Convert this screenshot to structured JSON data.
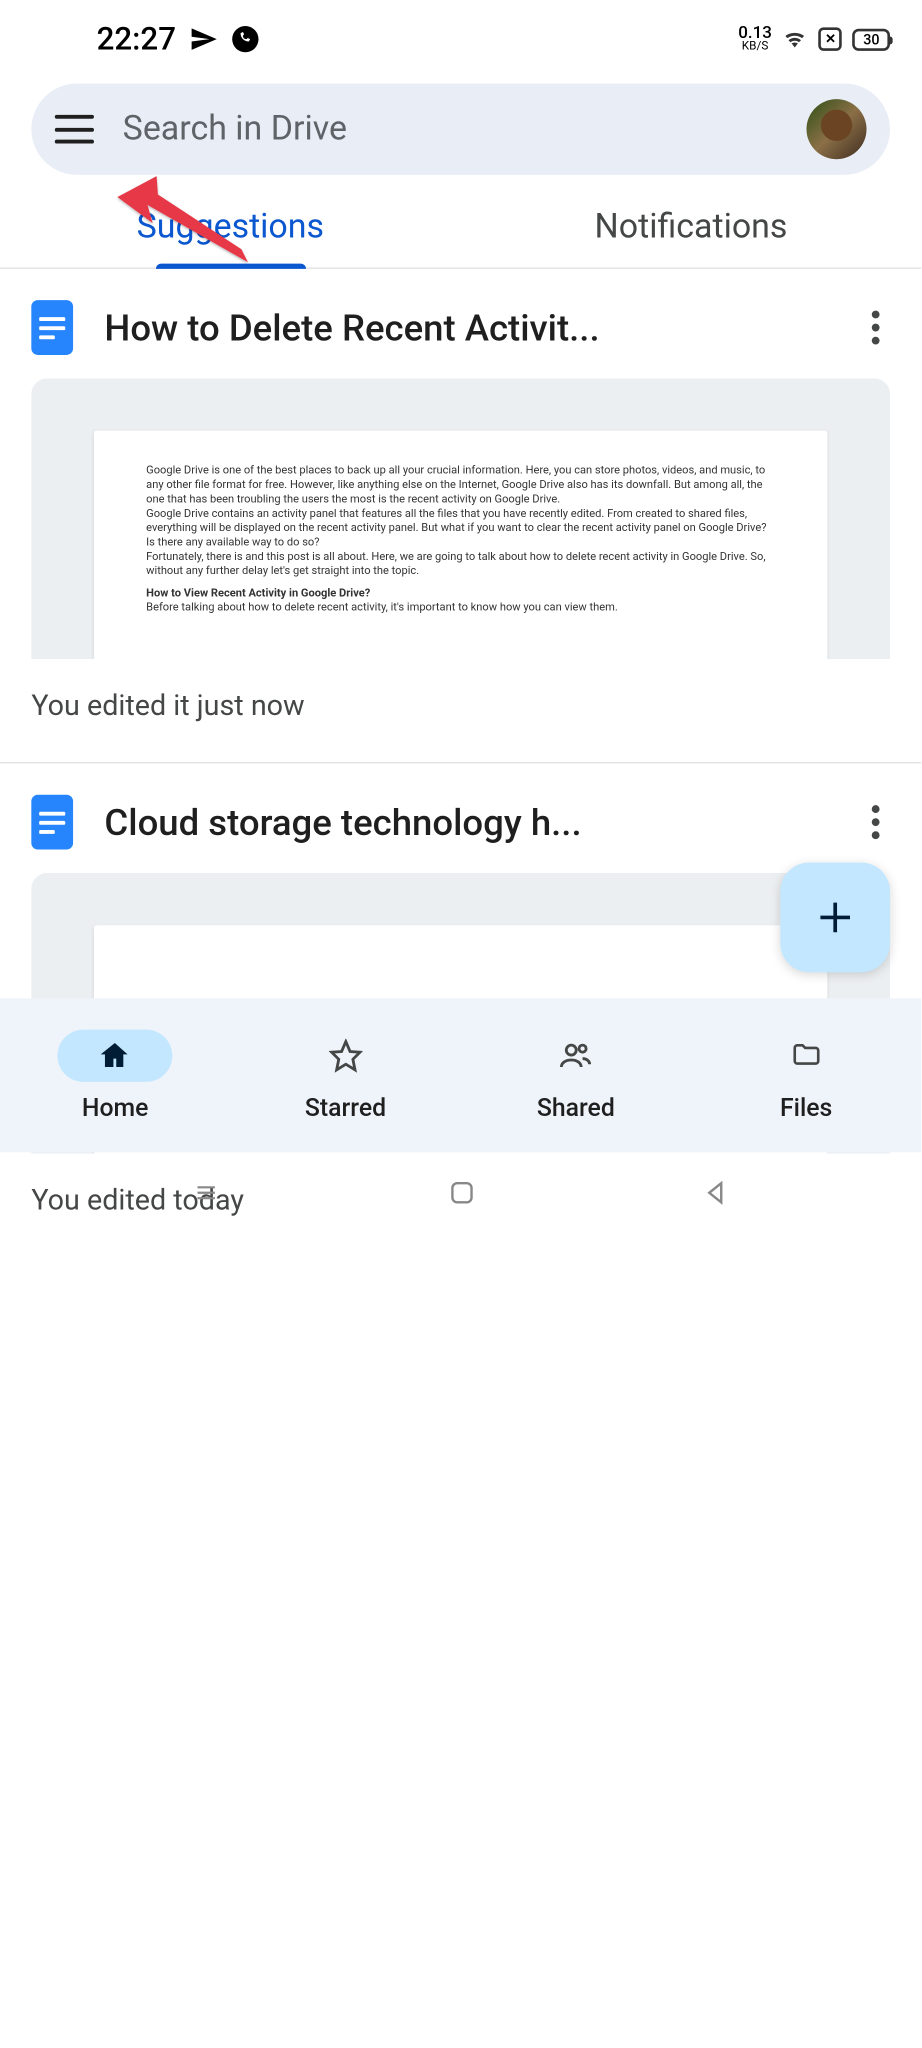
{
  "status": {
    "time": "22:27",
    "speed_value": "0.13",
    "speed_unit": "KB/S",
    "battery": "30"
  },
  "search": {
    "placeholder": "Search in Drive"
  },
  "tabs": {
    "suggestions": "Suggestions",
    "notifications": "Notifications"
  },
  "files": [
    {
      "title": "How to Delete Recent Activit...",
      "meta": "You edited it just now",
      "preview": {
        "p1": "Google Drive is one of the best places to back up all your crucial information. Here, you can store photos, videos, and music, to any other file format for free. However, like anything else on the Internet, Google Drive also has its downfall. But among all, the one that has been troubling the users the most is the recent activity on Google Drive.",
        "p2": "Google Drive contains an activity panel that features all the files that you have recently edited. From created to shared files, everything will be displayed on the recent activity panel. But what if you want to clear the recent activity panel on Google Drive? Is there any available way to do so?",
        "p3": "Fortunately, there is and this post is all about. Here, we are going to talk about how to delete recent activity in Google Drive. So, without any further delay let's get straight into the topic.",
        "heading": "How to View Recent Activity in Google Drive?",
        "p4": "Before talking about how to delete recent activity, it's important to know how you can view them."
      }
    },
    {
      "title": "Cloud storage technology h...",
      "meta": "You edited today"
    }
  ],
  "nav": {
    "home": "Home",
    "starred": "Starred",
    "shared": "Shared",
    "files": "Files"
  }
}
